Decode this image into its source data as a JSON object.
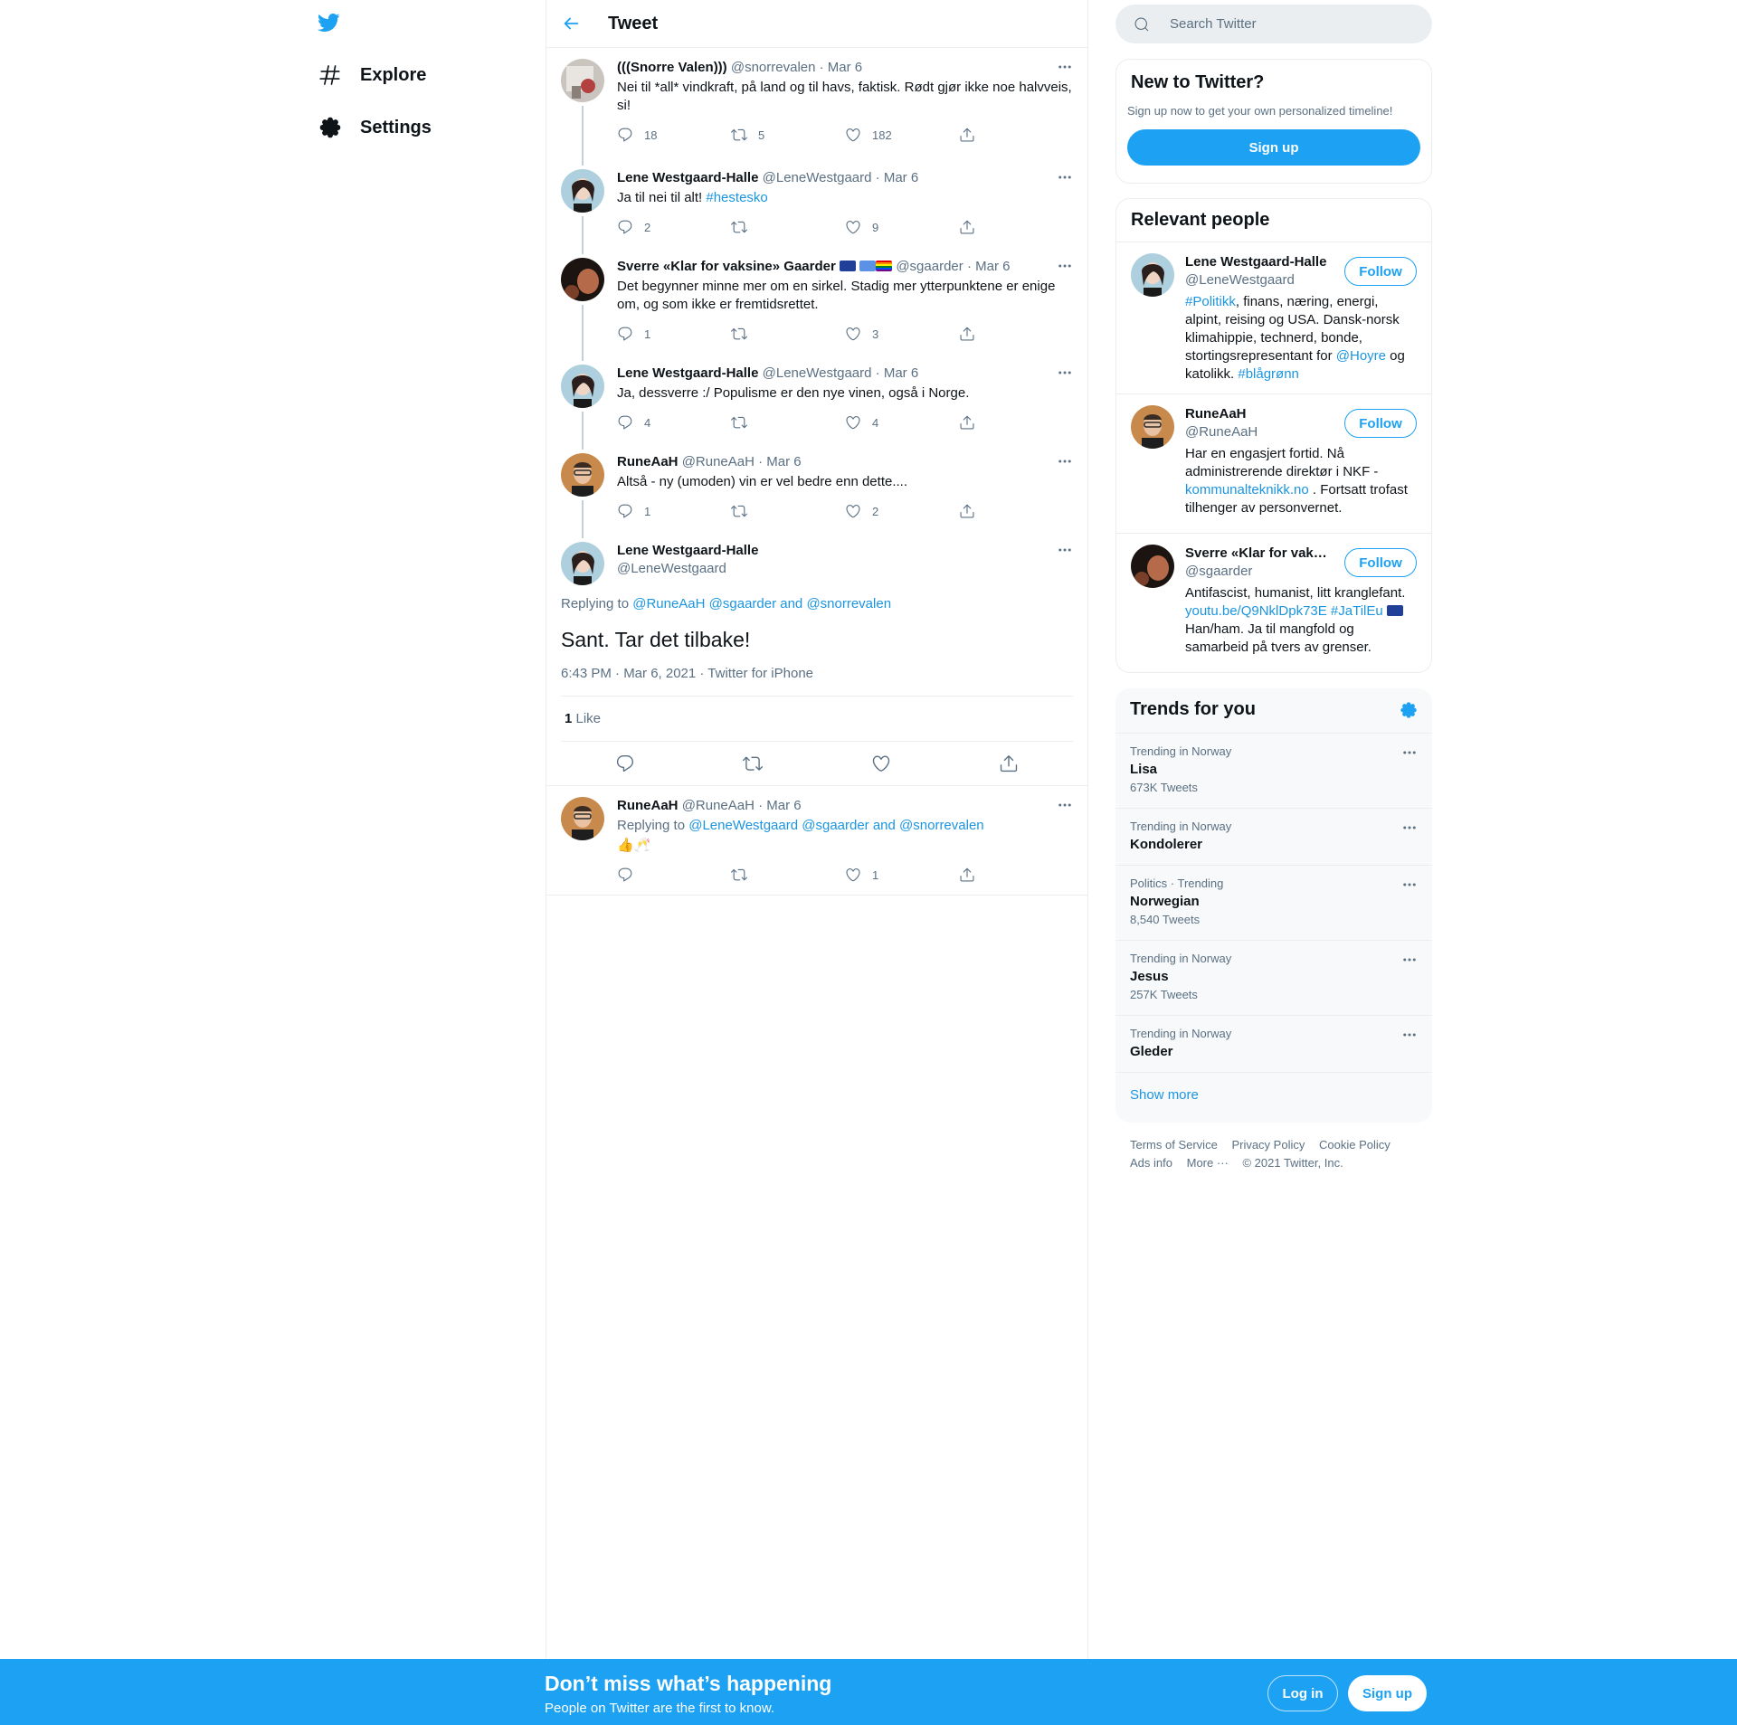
{
  "nav": {
    "items": [
      {
        "label": "Explore",
        "icon": "hashtag-icon"
      },
      {
        "label": "Settings",
        "icon": "gear-icon"
      }
    ]
  },
  "header": {
    "title": "Tweet"
  },
  "thread": [
    {
      "name": "(((Snorre Valen)))",
      "handle": "@snorrevalen",
      "date": "· Mar 6",
      "text": "Nei til *all* vindkraft, på land og til havs, faktisk. Rødt gjør ikke noe halvveis, si!",
      "replies": "18",
      "retweets": "5",
      "likes": "182"
    },
    {
      "name": "Lene Westgaard-Halle",
      "handle": "@LeneWestgaard",
      "date": "· Mar 6",
      "text": "Ja til nei til alt! ",
      "hashtag": "#hestesko",
      "replies": "2",
      "retweets": "",
      "likes": "9"
    },
    {
      "name": "Sverre «Klar for vaksine» Gaarder",
      "handle": "@sgaarder",
      "date": "· Mar 6",
      "text": "Det begynner minne mer om en sirkel. Stadig mer ytterpunktene er enige om, og som ikke er fremtidsrettet.",
      "replies": "1",
      "retweets": "",
      "likes": "3"
    },
    {
      "name": "Lene Westgaard-Halle",
      "handle": "@LeneWestgaard",
      "date": "· Mar 6",
      "text": "Ja, dessverre :/ Populisme er den nye vinen, også i Norge.",
      "replies": "4",
      "retweets": "",
      "likes": "4"
    },
    {
      "name": "RuneAaH",
      "handle": "@RuneAaH",
      "date": "· Mar 6",
      "text": "Altså - ny (umoden) vin er vel bedre enn dette....",
      "replies": "1",
      "retweets": "",
      "likes": "2"
    }
  ],
  "focus": {
    "name": "Lene Westgaard-Halle",
    "handle": "@LeneWestgaard",
    "replying_prefix": "Replying to ",
    "replying_to": "@RuneAaH @sgaarder and @snorrevalen",
    "text": "Sant. Tar det tilbake!",
    "meta": "6:43 PM · Mar 6, 2021 · Twitter for iPhone",
    "like_count": "1",
    "like_label": " Like"
  },
  "reply": {
    "name": "RuneAaH",
    "handle": "@RuneAaH",
    "date": "· Mar 6",
    "replying_prefix": "Replying to ",
    "replying_to": "@LeneWestgaard @sgaarder and @snorrevalen",
    "text": "👍🥂",
    "replies": "",
    "retweets": "",
    "likes": "1"
  },
  "search": {
    "placeholder": "Search Twitter"
  },
  "signup_card": {
    "title": "New to Twitter?",
    "subtitle": "Sign up now to get your own personalized timeline!",
    "button": "Sign up"
  },
  "people": {
    "title": "Relevant people",
    "follow_label": "Follow",
    "list": [
      {
        "name": "Lene Westgaard-Halle",
        "handle": "@LeneWestgaard",
        "bio_1_link": "#Politikk",
        "bio_1": ", finans, næring, energi, alpint, reising og USA. Dansk-norsk klimahippie, technerd, bonde, stortingsrepresentant for ",
        "bio_2_link": "@Hoyre",
        "bio_2": " og katolikk. ",
        "bio_3_link": "#blågrønn"
      },
      {
        "name": "RuneAaH",
        "handle": "@RuneAaH",
        "bio_1": "Har en engasjert fortid. Nå administrerende direktør i NKF - ",
        "bio_1_link": "kommunalteknikk.no",
        "bio_2": " . Fortsatt trofast tilhenger av personvernet."
      },
      {
        "name": "Sverre «Klar for vaksine» Gaarder",
        "handle": "@sgaarder",
        "bio_1": "Antifascist, humanist, litt kranglefant. ",
        "bio_1_link": "youtu.be/Q9NklDpk73E",
        "bio_2_link": " #JaTilEu",
        "bio_2": " Han/ham. Ja til mangfold og samarbeid på tvers av grenser."
      }
    ]
  },
  "trends": {
    "title": "Trends for you",
    "items": [
      {
        "context": "Trending in Norway",
        "name": "Lisa",
        "count": "673K Tweets"
      },
      {
        "context": "Trending in Norway",
        "name": "Kondolerer",
        "count": ""
      },
      {
        "context": "Politics · Trending",
        "name": "Norwegian",
        "count": "8,540 Tweets"
      },
      {
        "context": "Trending in Norway",
        "name": "Jesus",
        "count": "257K Tweets"
      },
      {
        "context": "Trending in Norway",
        "name": "Gleder",
        "count": ""
      }
    ],
    "show_more": "Show more"
  },
  "footer": {
    "links": [
      "Terms of Service",
      "Privacy Policy",
      "Cookie Policy",
      "Ads info",
      "More ···"
    ],
    "copyright": "© 2021 Twitter, Inc."
  },
  "bottom_bar": {
    "title": "Don’t miss what’s happening",
    "subtitle": "People on Twitter are the first to know.",
    "login": "Log in",
    "signup": "Sign up"
  },
  "colors": {
    "accent": "#1da1f2",
    "link": "#1b95e0",
    "muted": "#5b7083"
  }
}
